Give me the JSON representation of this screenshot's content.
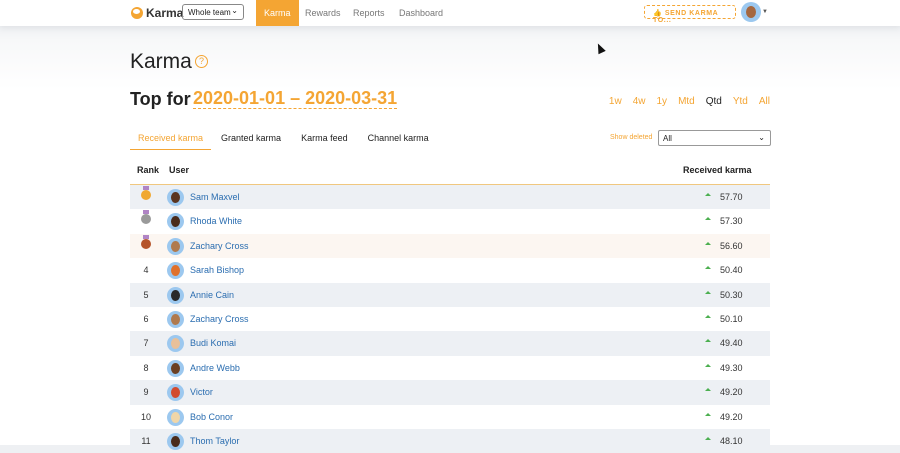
{
  "nav": {
    "logo": "Karma",
    "team_select": "Whole team",
    "tabs": [
      {
        "label": "Karma",
        "active": true
      },
      {
        "label": "Rewards"
      },
      {
        "label": "Reports"
      },
      {
        "label": "Dashboard"
      }
    ],
    "send_button": "SEND KARMA TO..."
  },
  "colors": {
    "accent": "#f4a533",
    "link": "#2a6db0",
    "up": "#4caf50"
  },
  "page": {
    "title": "Karma",
    "top_for": "Top for",
    "range": "2020-01-01 – 2020-03-31",
    "periods": [
      {
        "label": "1w"
      },
      {
        "label": "4w"
      },
      {
        "label": "1y"
      },
      {
        "label": "Mtd"
      },
      {
        "label": "Qtd",
        "selected": true
      },
      {
        "label": "Ytd"
      },
      {
        "label": "All"
      }
    ]
  },
  "tabs": [
    {
      "label": "Received karma",
      "active": true
    },
    {
      "label": "Granted karma"
    },
    {
      "label": "Karma feed"
    },
    {
      "label": "Channel karma"
    }
  ],
  "filter": {
    "label": "Show deleted",
    "value": "All"
  },
  "table": {
    "headers": {
      "rank": "Rank",
      "user": "User",
      "karma": "Received karma"
    },
    "rows": [
      {
        "rank": "1",
        "medal": "gold",
        "name": "Sam Maxvel",
        "value": "57.70",
        "trend": "up"
      },
      {
        "rank": "2",
        "medal": "silver",
        "name": "Rhoda White",
        "value": "57.30",
        "trend": "up"
      },
      {
        "rank": "3",
        "medal": "bronze",
        "name": "Zachary Cross",
        "value": "56.60",
        "trend": "up"
      },
      {
        "rank": "4",
        "name": "Sarah Bishop",
        "value": "50.40",
        "trend": "up"
      },
      {
        "rank": "5",
        "name": "Annie Cain",
        "value": "50.30",
        "trend": "up"
      },
      {
        "rank": "6",
        "name": "Zachary Cross",
        "value": "50.10",
        "trend": "up"
      },
      {
        "rank": "7",
        "name": "Budi Komai",
        "value": "49.40",
        "trend": "up"
      },
      {
        "rank": "8",
        "name": "Andre Webb",
        "value": "49.30",
        "trend": "up"
      },
      {
        "rank": "9",
        "name": "Victor",
        "value": "49.20",
        "trend": "up"
      },
      {
        "rank": "10",
        "name": "Bob Conor",
        "value": "49.20",
        "trend": "up"
      },
      {
        "rank": "11",
        "name": "Thom Taylor",
        "value": "48.10",
        "trend": "up"
      }
    ]
  }
}
